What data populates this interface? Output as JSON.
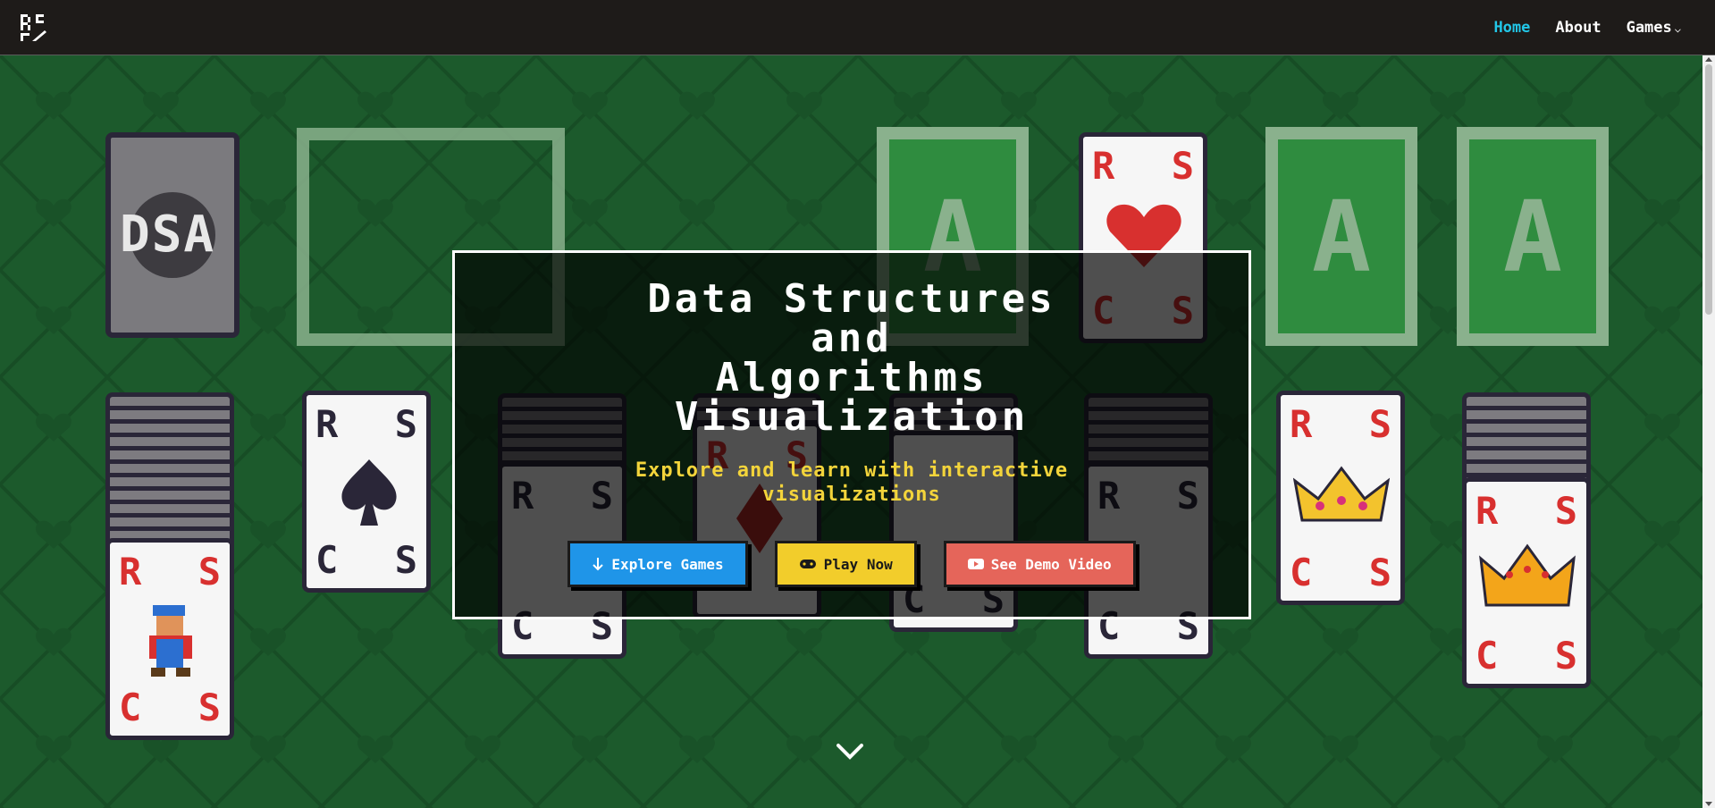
{
  "nav": {
    "links": [
      {
        "label": "Home",
        "active": true
      },
      {
        "label": "About",
        "active": false
      },
      {
        "label": "Games",
        "active": false
      }
    ],
    "games_chevron": "⌵"
  },
  "cards": {
    "deck_label": "DSA",
    "rank_r": "R",
    "rank_s": "S",
    "rank_c": "C",
    "slot_a": "A"
  },
  "hero": {
    "title_lines": [
      "Data Structures",
      "and",
      "Algorithms",
      "Visualization"
    ],
    "subtitle_lines": [
      "Explore and learn with interactive",
      "visualizations"
    ],
    "buttons": [
      {
        "label": "Explore Games",
        "icon": "arrow-down-icon"
      },
      {
        "label": "Play Now",
        "icon": "gamepad-icon"
      },
      {
        "label": "See Demo Video",
        "icon": "youtube-icon"
      }
    ]
  },
  "colors": {
    "nav_bg": "#1e1b19",
    "active_link": "#22c7e8",
    "felt": "#1c5a2c",
    "btn_blue": "#1f95e8",
    "btn_yellow": "#f2cd2b",
    "btn_red": "#e5655a",
    "subtitle": "#f3d43b"
  }
}
